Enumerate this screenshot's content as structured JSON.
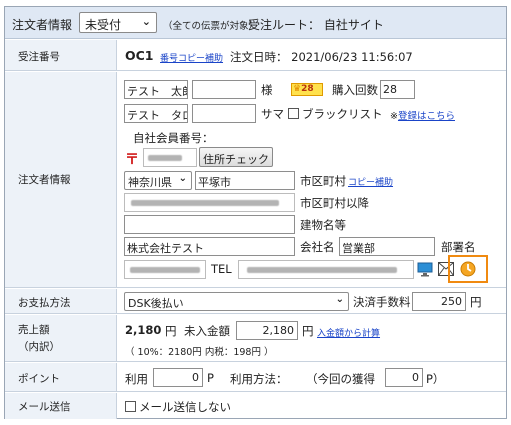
{
  "header": {
    "title": "注文者情報",
    "status_select": "未受付",
    "note": "（全ての伝票が対象）",
    "route": "受注ルート： 自社サイト"
  },
  "order": {
    "label": "受注番号",
    "number": "OC1",
    "copy_link": "番号コピー補助",
    "date": "注文日時： 2021/06/23 11:56:07"
  },
  "customer": {
    "label": "注文者情報",
    "last_name": "テスト　太郎",
    "first_name": "",
    "honorific": "様",
    "badge_value": "28",
    "purchase_count_label": "購入回数",
    "purchase_count": "28",
    "last_kana": "テスト　タロウ",
    "first_kana": "",
    "honorific_kana": "サマ",
    "blacklist_label": "ブラックリスト",
    "blacklist_note_prefix": "※",
    "blacklist_link": "登録はこちら",
    "member_label": "自社会員番号：",
    "postal_mark": "〒",
    "address_check": "住所チェック",
    "prefecture": "神奈川県",
    "city": "平塚市",
    "city_label": "市区町村",
    "city_copy": "コピー補助",
    "street_label": "市区町村以降",
    "building_label": "建物名等",
    "company": "株式会社テスト",
    "company_label": "会社名",
    "department": "営業部",
    "department_label": "部署名",
    "tel_label": "TEL"
  },
  "payment": {
    "label": "お支払方法",
    "method": "DSK後払い",
    "fee_label": "決済手数料",
    "fee": "250",
    "fee_unit": "円"
  },
  "sales": {
    "label_line1": "売上額",
    "label_line2": "（内訳）",
    "amount": "2,180",
    "amount_unit": "円",
    "unpaid_label": "未入金額",
    "unpaid": "2,180",
    "unpaid_unit": "円",
    "calc_link": "入金額から計算",
    "breakdown": "（ 10%：2180円 内税：198円 ）"
  },
  "points": {
    "label": "ポイント",
    "use_label": "利用",
    "use_value": "0",
    "use_unit": "P",
    "method_label": "利用方法：",
    "earn_label": "（今回の獲得",
    "earn_value": "0",
    "earn_unit": "P）"
  },
  "mail": {
    "label": "メール送信",
    "no_send": "メール送信しない"
  }
}
